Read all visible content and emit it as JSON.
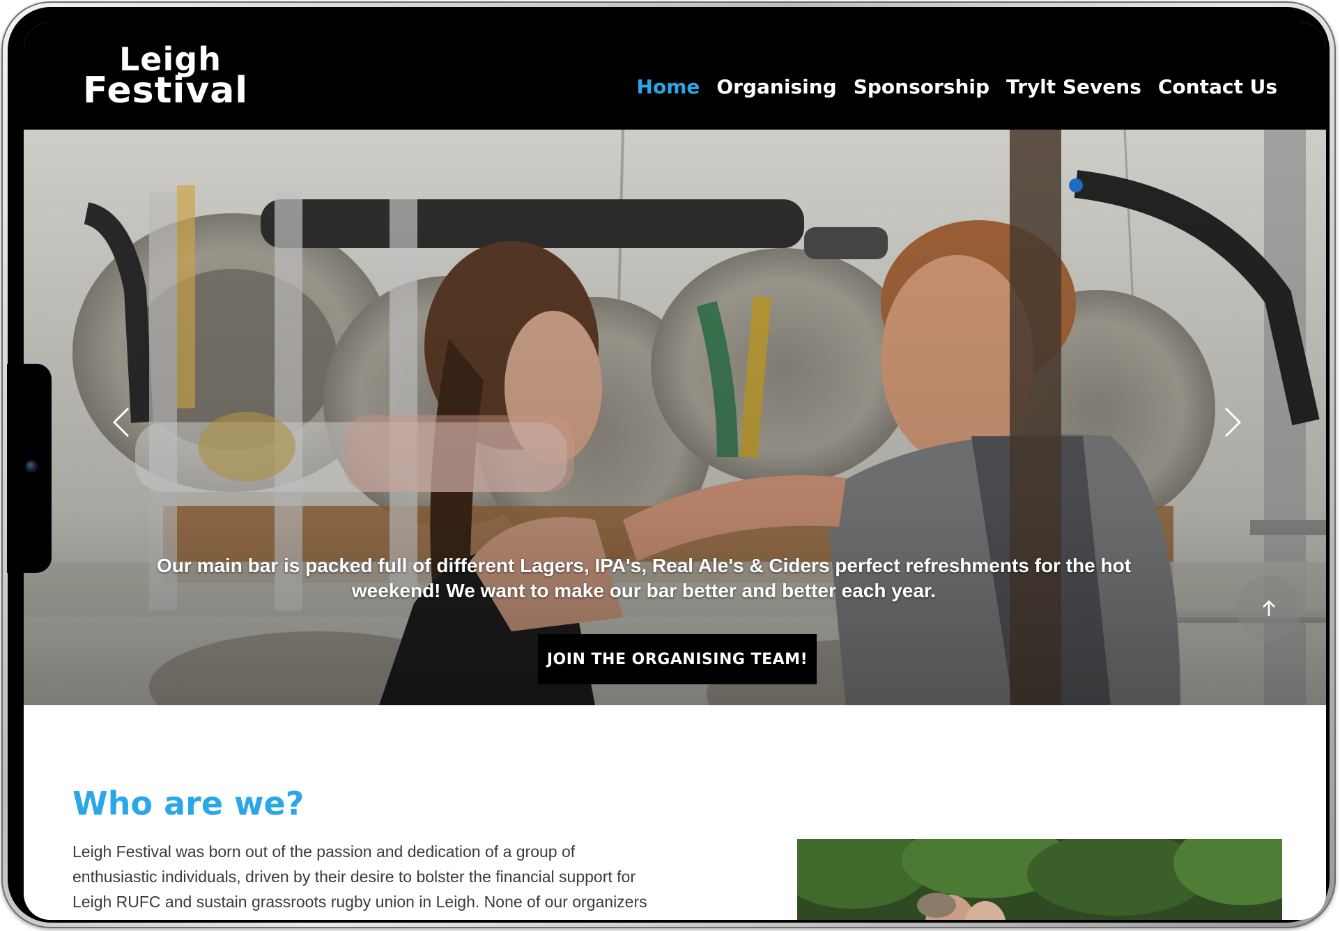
{
  "brand": {
    "logo_line1": "Leigh",
    "logo_line2": "Festival"
  },
  "nav": {
    "items": [
      {
        "label": "Home",
        "active": true
      },
      {
        "label": "Organising",
        "active": false
      },
      {
        "label": "Sponsorship",
        "active": false
      },
      {
        "label": "Trylt Sevens",
        "active": false
      },
      {
        "label": "Contact Us",
        "active": false
      }
    ]
  },
  "hero": {
    "caption": "Our main bar is packed full of different Lagers, IPA's, Real Ale's & Ciders perfect refreshments for the hot weekend! We want to make our bar better and better each year.",
    "cta_label": "JOIN THE ORGANISING TEAM!",
    "prev_icon": "chevron-left-icon",
    "next_icon": "chevron-right-icon",
    "scroll_top_icon": "arrow-up-icon"
  },
  "about": {
    "title": "Who are we?",
    "text": "Leigh Festival was born out of the passion and dedication of a group of enthusiastic individuals, driven by their desire to bolster the financial support for Leigh RUFC and sustain grassroots rugby union in Leigh. None of our organizers receive any monetary compensation, they tirelessly pour their efforts into creating"
  },
  "colors": {
    "accent": "#2aa7e8",
    "header_bg": "#000000",
    "text": "#3a3a3a"
  }
}
